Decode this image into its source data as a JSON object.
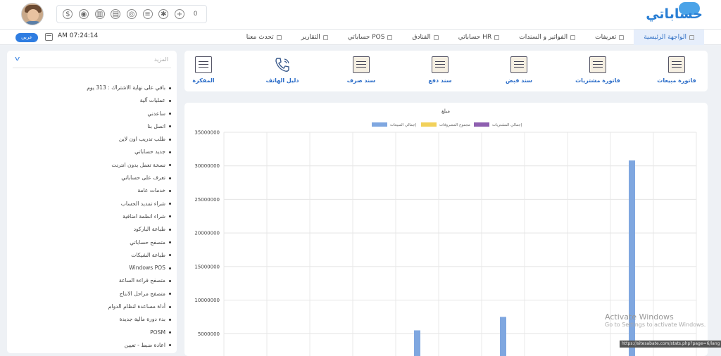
{
  "app": {
    "logo_text": "حساباتي"
  },
  "header": {
    "icon_toolbar": [
      "dollar-icon",
      "money-bag-icon",
      "building-icon",
      "printer-icon",
      "target-icon",
      "database-icon",
      "gear-icon",
      "plus-icon",
      "users-icon"
    ],
    "user_badge": "0"
  },
  "navbar": {
    "lang_button": "عربي",
    "time": "AM 07:24:14",
    "items": [
      {
        "label": "الواجهة الرئيسية",
        "active": true
      },
      {
        "label": "تعريفات"
      },
      {
        "label": "الفواتير و السندات"
      },
      {
        "label": "حساباتي HR"
      },
      {
        "label": "الفنادق"
      },
      {
        "label": "حساباتي POS"
      },
      {
        "label": "التقارير"
      },
      {
        "label": "تحدث معنا"
      }
    ]
  },
  "sidebar": {
    "more_label": "المزيد",
    "items": [
      "باقي على نهاية الاشتراك : 313 يوم",
      "عمليات آلية",
      "ساعدني",
      "اتصل بنا",
      "طلب تدريب اون لاين",
      "جديد حساباتي",
      "نسخة تعمل بدون انترنت",
      "تعرف على حساباتي",
      "خدمات عامة",
      "شراء تمديد الحساب",
      "شراء انظمة اضافية",
      "طباعة الباركود",
      "متصفح حساباتي",
      "طباعة الشيكات",
      "Windows POS",
      "متصفح قراءة الساعة",
      "متصفح مراحل الانتاج",
      "أداة مساعدة لنظام الدوام",
      "بدء دورة مالية جديدة",
      "POSM",
      "اعادة ضبط - تعيين"
    ]
  },
  "shortcuts": [
    {
      "label": "فاتورة مبيعات",
      "icon": "clipboard-icon"
    },
    {
      "label": "فاتورة مشتريات",
      "icon": "clipboard-icon"
    },
    {
      "label": "سند قبض",
      "icon": "document-pen-icon"
    },
    {
      "label": "سند دفع",
      "icon": "document-pen-icon"
    },
    {
      "label": "سند صرف",
      "icon": "document-pen-icon"
    },
    {
      "label": "دليل الهاتف",
      "icon": "phone-icon"
    },
    {
      "label": "المفكرة",
      "icon": "notebook-icon"
    }
  ],
  "chart_data": {
    "type": "bar",
    "title": "مبلغ",
    "legend": [
      {
        "name": "إجمالي المبيعات",
        "color": "#7fa7e0"
      },
      {
        "name": "مجموع المصروفات",
        "color": "#f2d15a"
      },
      {
        "name": "إجمالي المشتريات",
        "color": "#8e5fb0"
      }
    ],
    "series": [
      {
        "name": "إجمالي المبيعات",
        "values": [
          0,
          0,
          0,
          0,
          5500000,
          0,
          7500000,
          0,
          0,
          30800000,
          0
        ]
      }
    ],
    "categories": [
      "",
      "",
      "",
      "",
      "",
      "",
      "",
      "",
      "",
      "",
      ""
    ],
    "ylim": [
      0,
      35000000
    ],
    "yticks": [
      "35000000",
      "30000000",
      "25000000",
      "20000000",
      "15000000",
      "10000000",
      "5000000"
    ],
    "grid": true,
    "legend_position": "top"
  },
  "watermark": {
    "line1": "Activate Windows",
    "line2": "Go to Settings to activate Windows."
  },
  "status_url": "https://sitesabate.com/stats.php?page=6/lang"
}
